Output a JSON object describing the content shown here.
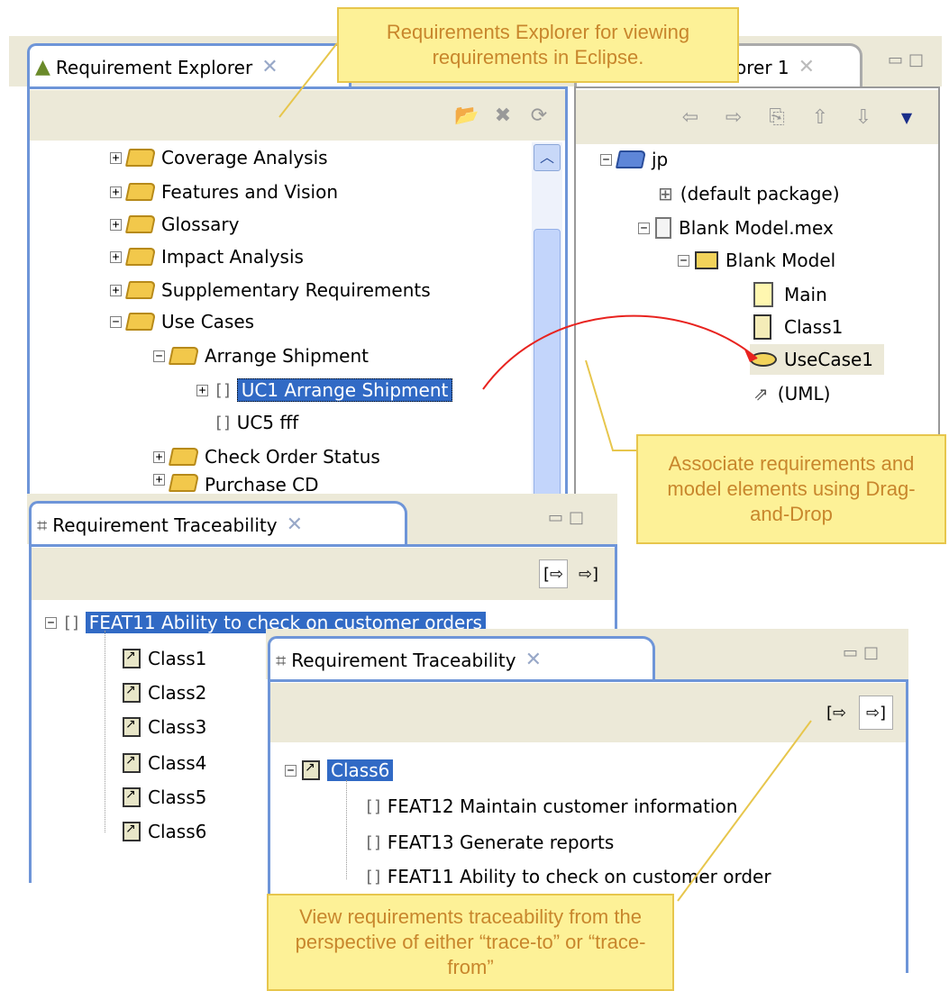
{
  "explorer": {
    "title": "Requirement Explorer",
    "toolbar_icons": [
      "open-folder-icon",
      "delete-icon",
      "refresh-icon"
    ],
    "items": [
      {
        "label": "Coverage Analysis"
      },
      {
        "label": "Features and Vision"
      },
      {
        "label": "Glossary"
      },
      {
        "label": "Impact Analysis"
      },
      {
        "label": "Supplementary Requirements"
      },
      {
        "label": "Use Cases"
      },
      {
        "label": "Arrange Shipment"
      },
      {
        "label": "UC1 Arrange Shipment"
      },
      {
        "label": "UC5 fff"
      },
      {
        "label": "Check Order Status"
      },
      {
        "label": "Purchase CD"
      }
    ]
  },
  "package_explorer": {
    "title": "orer 1",
    "items": [
      {
        "label": "jp"
      },
      {
        "label": "(default package)"
      },
      {
        "label": "Blank Model.mex"
      },
      {
        "label": "Blank Model"
      },
      {
        "label": "Main"
      },
      {
        "label": "Class1"
      },
      {
        "label": "UseCase1"
      },
      {
        "label": "(UML)"
      }
    ]
  },
  "trace1": {
    "title": "Requirement Traceability",
    "root": "FEAT11 Ability to check on customer orders",
    "children": [
      "Class1",
      "Class2",
      "Class3",
      "Class4",
      "Class5",
      "Class6"
    ]
  },
  "trace2": {
    "title": "Requirement Traceability",
    "root": "Class6",
    "children": [
      "FEAT12 Maintain customer information",
      "FEAT13 Generate reports",
      "FEAT11 Ability to check on customer order"
    ]
  },
  "callouts": {
    "explorer": "Requirements Explorer for viewing requirements in Eclipse.",
    "dnd": "Associate requirements and model elements using Drag-and-Drop",
    "trace": "View requirements traceability from the perspective of either “trace-to” or “trace-from”"
  },
  "colors": {
    "selection": "#316ac5",
    "callout_bg": "#fdf197",
    "callout_text": "#c8862c",
    "drag_arrow": "#e8231f"
  }
}
